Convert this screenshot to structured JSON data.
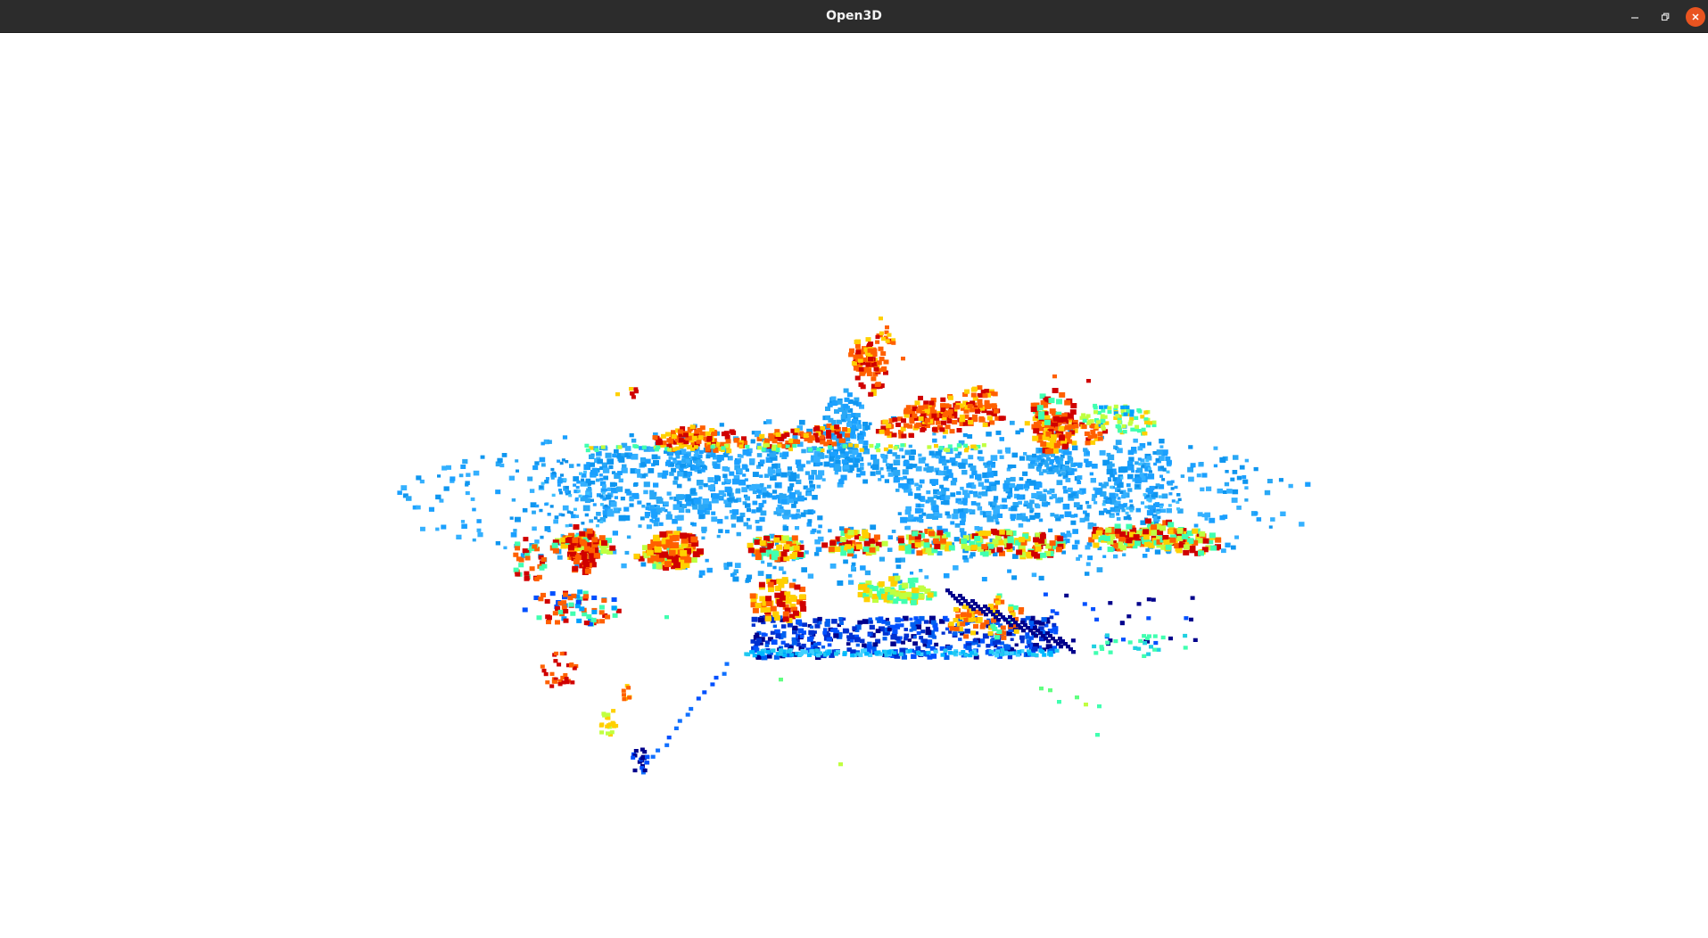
{
  "window": {
    "title": "Open3D",
    "controls": {
      "minimize_icon": "minimize-icon",
      "maximize_icon": "restore-icon",
      "close_icon": "close-icon",
      "close_color": "#e95420"
    }
  },
  "viewer": {
    "background": "#ffffff",
    "content": "lidar-point-cloud",
    "colormap": [
      "#00008b",
      "#0050ff",
      "#00a0ff",
      "#40ffb0",
      "#c0ff40",
      "#ffd000",
      "#ff6000",
      "#d00000"
    ]
  }
}
